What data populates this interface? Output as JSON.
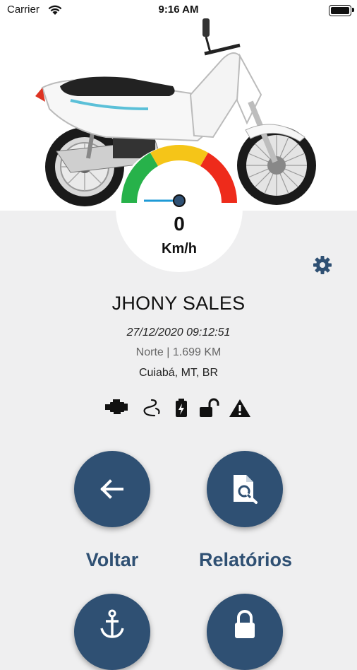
{
  "status_bar": {
    "carrier": "Carrier",
    "time": "9:16 AM"
  },
  "speedometer": {
    "value": "0",
    "unit": "Km/h",
    "zone_colors": [
      "#27b24a",
      "#f5c518",
      "#ee2b1b"
    ]
  },
  "vehicle": {
    "owner_name": "JHONY SALES",
    "timestamp": "27/12/2020 09:12:51",
    "direction_distance": "Norte | 1.699 KM",
    "location": "Cuiabá, MT, BR"
  },
  "status_icons": [
    "engine-icon",
    "road-icon",
    "battery-icon",
    "unlock-icon",
    "warning-icon"
  ],
  "actions": [
    {
      "label": "Voltar",
      "icon": "arrow-left-icon"
    },
    {
      "label": "Relatórios",
      "icon": "report-search-icon"
    },
    {
      "label": "",
      "icon": "anchor-icon"
    },
    {
      "label": "",
      "icon": "lock-icon"
    }
  ],
  "colors": {
    "primary": "#2f5073",
    "background": "#efeff0"
  }
}
